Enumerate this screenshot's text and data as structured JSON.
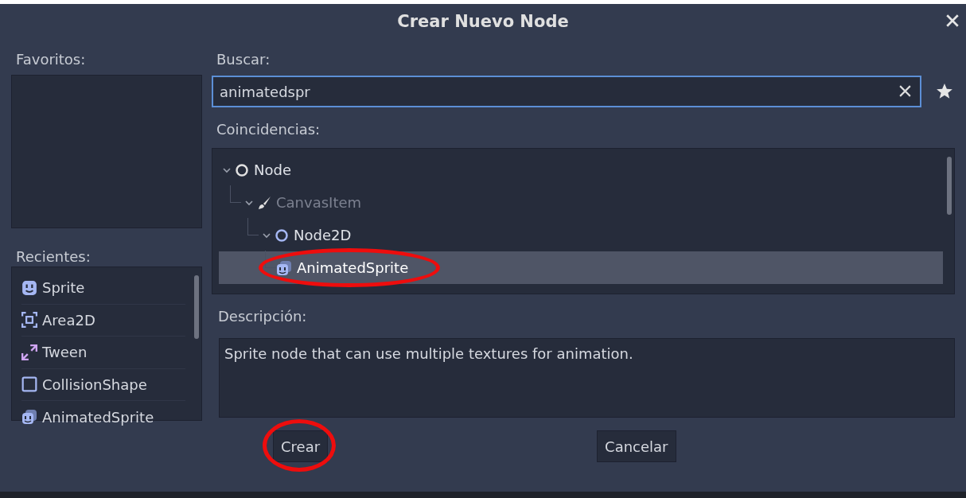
{
  "window": {
    "title": "Crear Nuevo Node"
  },
  "favorites": {
    "label": "Favoritos:"
  },
  "recents": {
    "label": "Recientes:",
    "items": [
      {
        "label": "Sprite",
        "kind": "sprite"
      },
      {
        "label": "Area2D",
        "kind": "area"
      },
      {
        "label": "Tween",
        "kind": "tween"
      },
      {
        "label": "CollisionShape",
        "kind": "shape"
      },
      {
        "label": "AnimatedSprite",
        "kind": "animated"
      }
    ]
  },
  "search": {
    "label": "Buscar:",
    "value": "animatedspr"
  },
  "matches": {
    "label": "Coincidencias:",
    "tree": [
      {
        "label": "Node",
        "kind": "node",
        "disabled": false,
        "selected": false,
        "circled": false,
        "expanded": true,
        "children": [
          {
            "label": "CanvasItem",
            "kind": "brush",
            "disabled": true,
            "selected": false,
            "circled": false,
            "expanded": true,
            "children": [
              {
                "label": "Node2D",
                "kind": "node2d",
                "disabled": false,
                "selected": false,
                "circled": false,
                "expanded": true,
                "children": [
                  {
                    "label": "AnimatedSprite",
                    "kind": "animated",
                    "disabled": false,
                    "selected": true,
                    "circled": true
                  }
                ]
              }
            ]
          }
        ]
      }
    ]
  },
  "description": {
    "label": "Descripción:",
    "text": "Sprite node that can use multiple textures for animation."
  },
  "buttons": [
    {
      "label": "Crear",
      "circled": true
    },
    {
      "label": "Cancelar",
      "circled": false
    }
  ]
}
